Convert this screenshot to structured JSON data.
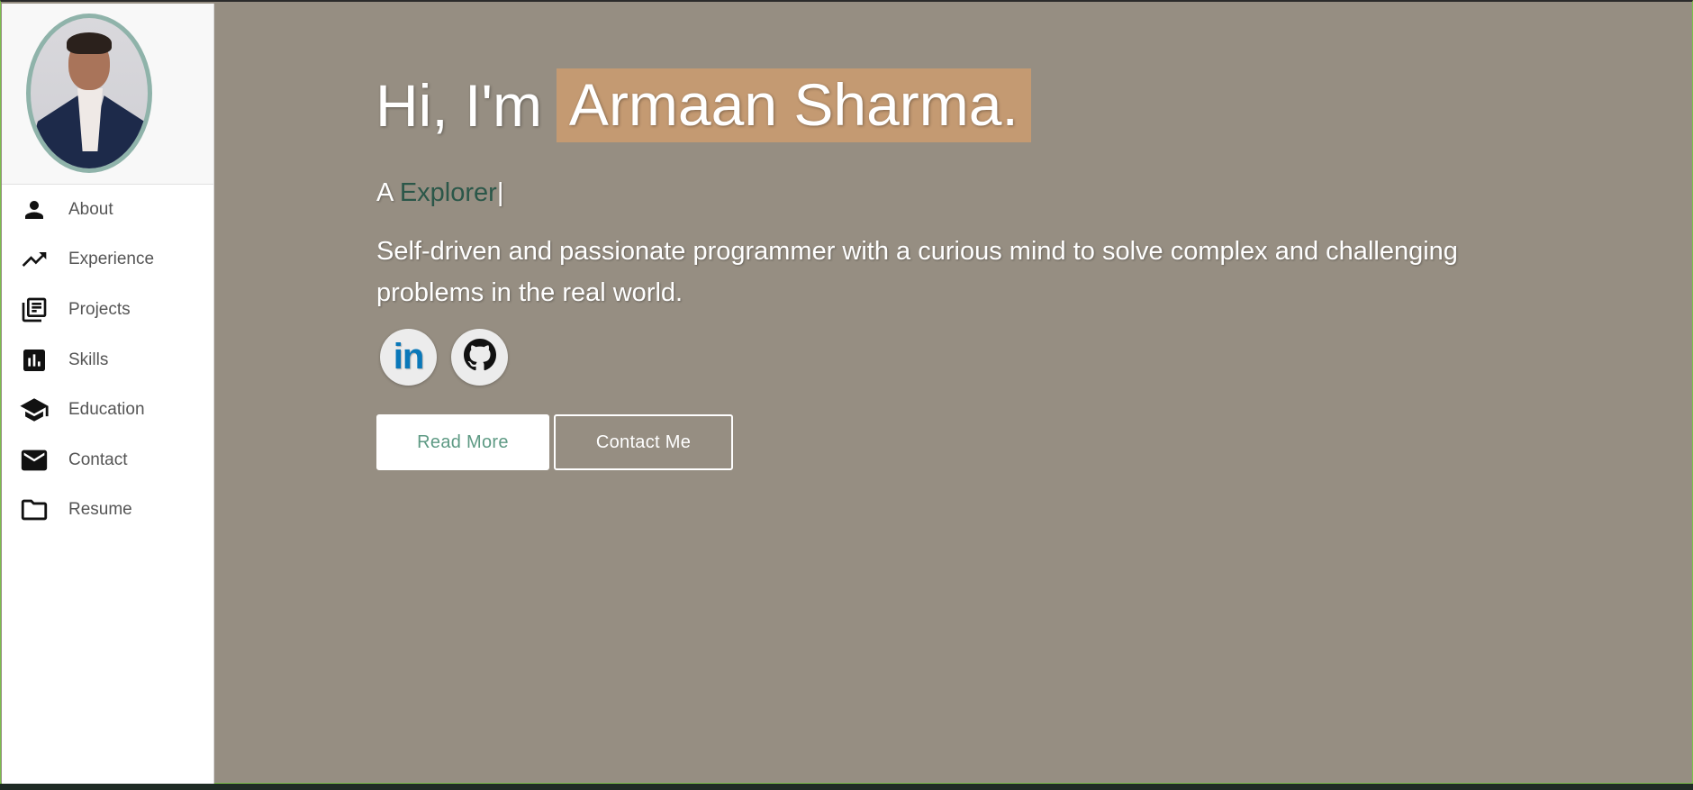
{
  "sidebar": {
    "profile_alt": "Armaan Sharma profile photo",
    "items": [
      {
        "label": "About",
        "icon": "person-icon"
      },
      {
        "label": "Experience",
        "icon": "trending-up-icon"
      },
      {
        "label": "Projects",
        "icon": "library-books-icon"
      },
      {
        "label": "Skills",
        "icon": "bar-chart-icon"
      },
      {
        "label": "Education",
        "icon": "school-icon"
      },
      {
        "label": "Contact",
        "icon": "mail-icon"
      },
      {
        "label": "Resume",
        "icon": "folder-icon"
      }
    ]
  },
  "hero": {
    "greeting": "Hi, I'm",
    "name": "Armaan Sharma.",
    "typed_prefix": "A",
    "typed_role": "Explorer",
    "typed_cursor": "|",
    "description": "Self-driven and passionate programmer with a curious mind to solve complex and challenging problems in the real world.",
    "socials": [
      {
        "name": "LinkedIn",
        "icon": "linkedin-icon",
        "glyph": "in"
      },
      {
        "name": "GitHub",
        "icon": "github-icon"
      }
    ],
    "buttons": {
      "read_more": "Read More",
      "contact_me": "Contact Me"
    }
  },
  "colors": {
    "background": "#968e82",
    "name_highlight": "#c49a72",
    "role_text": "#2b5749",
    "sidebar_bg": "#ffffff",
    "avatar_border": "#8fb3aa",
    "linkedin_blue": "#0a78b9"
  }
}
